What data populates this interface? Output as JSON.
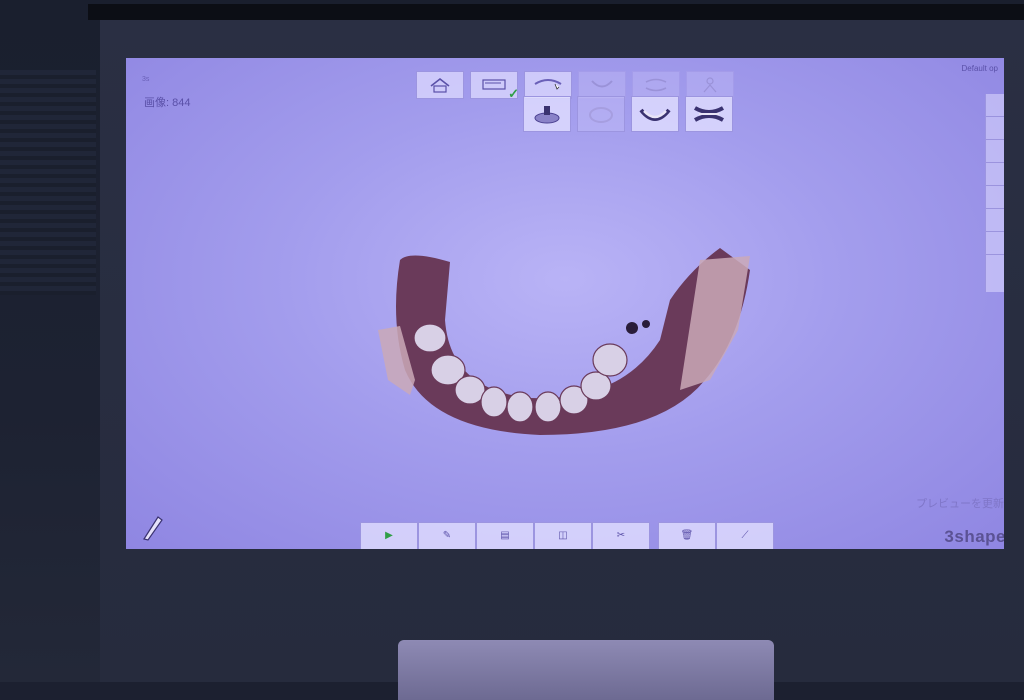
{
  "ui": {
    "image_count_label": "画像: 844",
    "layout_label": "Default op",
    "corner_mark": "3s",
    "preview_label": "プレビューを更新",
    "brand": "3shape",
    "top_toolbar": [
      {
        "icon": "home-icon"
      },
      {
        "icon": "scan-settings-icon",
        "checked": true
      },
      {
        "icon": "lower-jaw-icon",
        "active": true
      },
      {
        "icon": "upper-jaw-icon"
      },
      {
        "icon": "bite-icon"
      },
      {
        "icon": "patient-icon"
      }
    ],
    "sub_toolbar": [
      {
        "icon": "prep-scan-icon"
      },
      {
        "icon": "antagonist-icon"
      },
      {
        "icon": "lower-arch-icon"
      },
      {
        "icon": "upper-arch-icon"
      }
    ],
    "bottom_toolbar": [
      {
        "icon": "play-icon"
      },
      {
        "icon": "brush-icon"
      },
      {
        "icon": "document-icon"
      },
      {
        "icon": "camera-icon"
      },
      {
        "icon": "tools-icon"
      },
      {
        "icon": "trash-icon"
      },
      {
        "icon": "wand-icon"
      }
    ]
  },
  "colors": {
    "background": "#a39ded",
    "model_gum": "#6a3a5a",
    "teeth": "#d8d0e6",
    "check": "#2f9e46"
  }
}
